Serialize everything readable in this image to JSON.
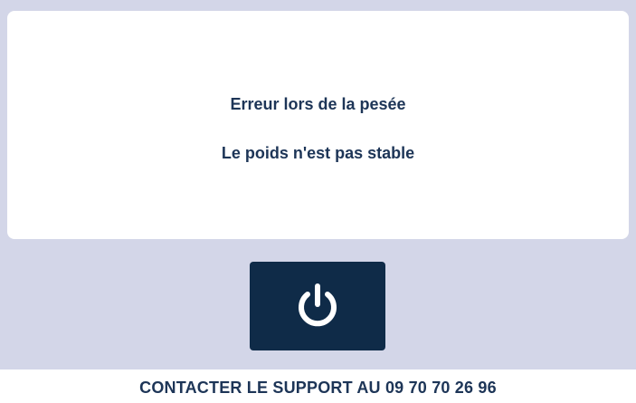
{
  "message": {
    "title": "Erreur lors de la pesée",
    "detail": "Le poids n'est pas stable"
  },
  "power_button": {
    "icon": "power-icon"
  },
  "footer": {
    "text": "CONTACTER LE SUPPORT AU 09 70 70 26 96"
  },
  "colors": {
    "background": "#d3d6e8",
    "card": "#ffffff",
    "text": "#1d3557",
    "button": "#0f2b48",
    "icon": "#ffffff"
  }
}
